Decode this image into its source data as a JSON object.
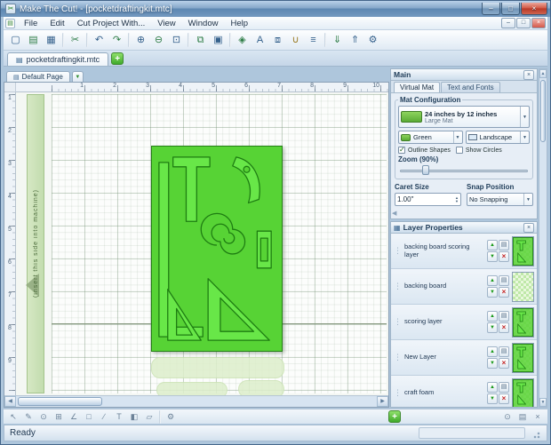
{
  "window": {
    "title": "Make The Cut! - [pocketdraftingkit.mtc]",
    "controls": [
      {
        "name": "minimize-button",
        "glyph": "–"
      },
      {
        "name": "maximize-button",
        "glyph": "□"
      },
      {
        "name": "close-button",
        "glyph": "×"
      }
    ]
  },
  "menubar": [
    "File",
    "Edit",
    "Cut Project With...",
    "View",
    "Window",
    "Help"
  ],
  "mdi_controls": [
    {
      "name": "mdi-minimize-button",
      "glyph": "–"
    },
    {
      "name": "mdi-restore-button",
      "glyph": "□"
    },
    {
      "name": "mdi-close-button",
      "glyph": "×"
    }
  ],
  "toolbar": [
    {
      "name": "new-file-icon",
      "glyph": "▢"
    },
    {
      "name": "open-file-icon",
      "glyph": "▤"
    },
    {
      "name": "save-file-icon",
      "glyph": "▦"
    },
    {
      "name": "toolbar-separator",
      "sep": true,
      "glyph": ""
    },
    {
      "name": "cut-project-icon",
      "glyph": "✂"
    },
    {
      "name": "toolbar-separator",
      "sep": true,
      "glyph": ""
    },
    {
      "name": "undo-icon",
      "glyph": "↶"
    },
    {
      "name": "redo-icon",
      "glyph": "↷"
    },
    {
      "name": "toolbar-separator",
      "sep": true,
      "glyph": ""
    },
    {
      "name": "zoom-in-icon",
      "glyph": "⊕"
    },
    {
      "name": "zoom-out-icon",
      "glyph": "⊖"
    },
    {
      "name": "zoom-fit-icon",
      "glyph": "⊡"
    },
    {
      "name": "toolbar-separator",
      "sep": true,
      "glyph": ""
    },
    {
      "name": "copy-icon",
      "glyph": "⧉"
    },
    {
      "name": "paste-icon",
      "glyph": "▣"
    },
    {
      "name": "toolbar-separator",
      "sep": true,
      "glyph": ""
    },
    {
      "name": "shapes-library-icon",
      "glyph": "◈"
    },
    {
      "name": "text-tool-icon",
      "glyph": "A"
    },
    {
      "name": "group-icon",
      "glyph": "⧈"
    },
    {
      "name": "weld-icon",
      "glyph": "∪"
    },
    {
      "name": "align-icon",
      "glyph": "≡"
    },
    {
      "name": "toolbar-separator",
      "sep": true,
      "glyph": ""
    },
    {
      "name": "import-icon",
      "glyph": "⇓"
    },
    {
      "name": "export-icon",
      "glyph": "⇑"
    },
    {
      "name": "settings-icon",
      "glyph": "⚙"
    }
  ],
  "doc_tab": {
    "label": "pocketdraftingkit.mtc",
    "add_label": "+"
  },
  "page_tab": {
    "label": "Default Page"
  },
  "canvas": {
    "machine_side_label": "(insert this side into machine)",
    "h_ruler": [
      "1",
      "2",
      "3",
      "4",
      "5",
      "6",
      "7",
      "8",
      "9",
      "10"
    ],
    "v_ruler": [
      "1",
      "2",
      "3",
      "4",
      "5",
      "6",
      "7",
      "8",
      "9"
    ]
  },
  "main_panel": {
    "title": "Main",
    "close_label": "×",
    "tabs": [
      {
        "label": "Virtual Mat",
        "active": true
      },
      {
        "label": "Text and Fonts",
        "active": false
      }
    ],
    "mat_config": {
      "group_label": "Mat Configuration",
      "size_title": "24 inches by 12 inches",
      "size_subtitle": "Large Mat",
      "color_value": "Green",
      "orientation_value": "Landscape",
      "outline_shapes_label": "Outline Shapes",
      "outline_shapes_checked": true,
      "show_circles_label": "Show Circles",
      "show_circles_checked": false,
      "zoom_label": "Zoom (90%)",
      "caret_size_label": "Caret Size",
      "caret_size_value": "1.00\"",
      "snap_label": "Snap Position",
      "snap_value": "No Snapping"
    }
  },
  "layers_panel": {
    "title": "Layer Properties",
    "close_label": "×",
    "layers": [
      {
        "name": "backing board scoring layer",
        "has_shapes": true
      },
      {
        "name": "backing board",
        "has_shapes": false
      },
      {
        "name": "scoring layer",
        "has_shapes": true
      },
      {
        "name": "New Layer",
        "has_shapes": true
      },
      {
        "name": "craft foam",
        "has_shapes": true
      }
    ],
    "add_label": "+"
  },
  "bottom_toolbar": [
    {
      "name": "select-tool-icon",
      "glyph": "↖"
    },
    {
      "name": "node-edit-tool-icon",
      "glyph": "✎"
    },
    {
      "name": "zoom-tool-icon",
      "glyph": "⊙"
    },
    {
      "name": "pan-tool-icon",
      "glyph": "⊞"
    },
    {
      "name": "measure-tool-icon",
      "glyph": "∠"
    },
    {
      "name": "shape-tool-icon",
      "glyph": "□"
    },
    {
      "name": "line-tool-icon",
      "glyph": "∕"
    },
    {
      "name": "text-insert-tool-icon",
      "glyph": "T"
    },
    {
      "name": "fill-tool-icon",
      "glyph": "◧"
    },
    {
      "name": "eraser-tool-icon",
      "glyph": "▱"
    },
    {
      "name": "toolbar-separator",
      "sep": true,
      "glyph": ""
    },
    {
      "name": "wrench-icon",
      "glyph": "⚙"
    }
  ],
  "layer_footer_icons": [
    {
      "name": "zoom-layers-icon",
      "glyph": "⊙"
    },
    {
      "name": "print-mat-icon",
      "glyph": "▤"
    },
    {
      "name": "close-layers-icon",
      "glyph": "×"
    }
  ],
  "icons": {
    "app": "✂",
    "document": "▤",
    "layers": "▦",
    "page_dropdown": "▼",
    "dropdown_arrow": "▼",
    "check": "✓",
    "up_arrow": "▲",
    "down_arrow": "▼",
    "print": "▤",
    "grip": "⋮",
    "spin_up": "▲",
    "spin_down": "▼",
    "scroll_up": "▲",
    "scroll_down": "▼",
    "scroll_left": "◀",
    "scroll_right": "▶",
    "delete": "×"
  },
  "statusbar": {
    "text": "Ready"
  }
}
